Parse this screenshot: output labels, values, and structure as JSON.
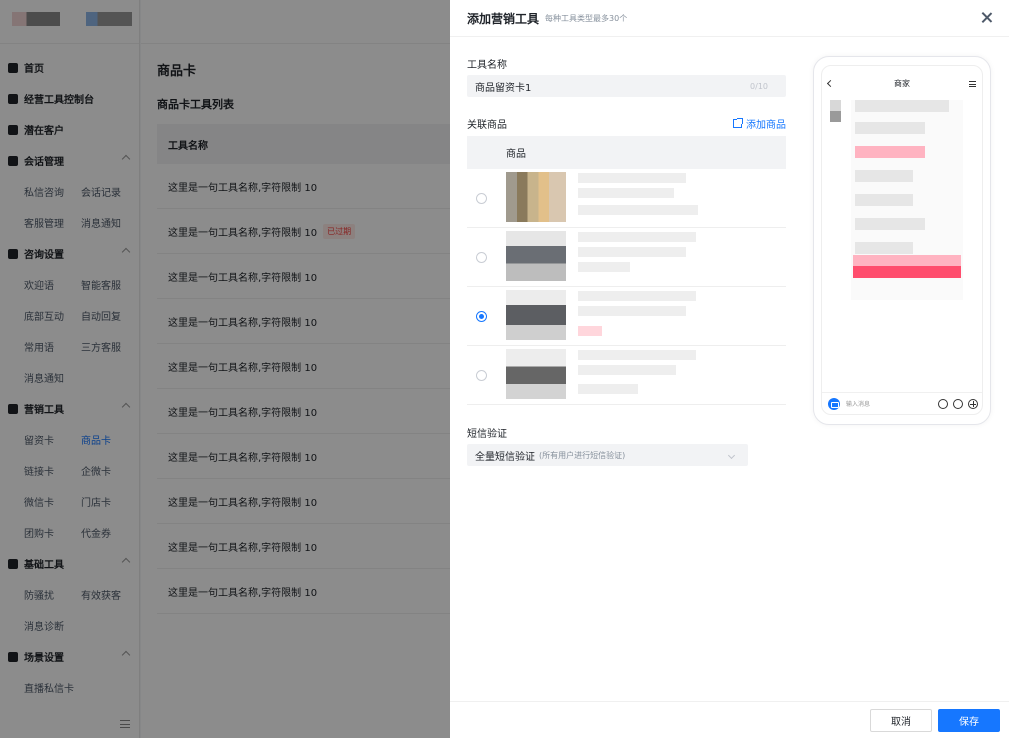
{
  "sidebar": {
    "groups": [
      {
        "label": "首页",
        "items": []
      },
      {
        "label": "经营工具控制台",
        "items": []
      },
      {
        "label": "潜在客户",
        "items": []
      },
      {
        "label": "会话管理",
        "items": [
          "私信咨询",
          "会话记录",
          "客服管理",
          "消息通知"
        ]
      },
      {
        "label": "咨询设置",
        "items": [
          "欢迎语",
          "智能客服",
          "底部互动",
          "自动回复",
          "常用语",
          "三方客服",
          "消息通知"
        ]
      },
      {
        "label": "营销工具",
        "items": [
          "留资卡",
          "商品卡",
          "链接卡",
          "企微卡",
          "微信卡",
          "门店卡",
          "团购卡",
          "代金券"
        ]
      },
      {
        "label": "基础工具",
        "items": [
          "防骚扰",
          "有效获客",
          "消息诊断"
        ]
      },
      {
        "label": "场景设置",
        "items": [
          "直播私信卡"
        ]
      }
    ],
    "active_item": "商品卡"
  },
  "main": {
    "page_title": "商品卡",
    "list_title": "商品卡工具列表",
    "column_tool_name": "工具名称",
    "rows": [
      "这里是一句工具名称,字符限制 10",
      "这里是一句工具名称,字符限制 10",
      "这里是一句工具名称,字符限制 10",
      "这里是一句工具名称,字符限制 10",
      "这里是一句工具名称,字符限制 10",
      "这里是一句工具名称,字符限制 10",
      "这里是一句工具名称,字符限制 10",
      "这里是一句工具名称,字符限制 10",
      "这里是一句工具名称,字符限制 10",
      "这里是一句工具名称,字符限制 10"
    ],
    "expired_tag": "已过期"
  },
  "drawer": {
    "title": "添加营销工具",
    "subtitle": "每种工具类型最多30个",
    "tool_name_label": "工具名称",
    "tool_name_value": "商品留资卡1",
    "tool_name_count": "0/10",
    "goods_label": "关联商品",
    "add_goods": "添加商品",
    "goods_column": "商品",
    "selected_goods_index": 2,
    "sms_label": "短信验证",
    "sms_value": "全量短信验证",
    "sms_hint": "(所有用户进行短信验证)",
    "cancel": "取消",
    "save": "保存"
  },
  "phone": {
    "title": "商家",
    "input_placeholder": "输入消息"
  },
  "colors": {
    "primary": "#1677ff",
    "danger": "#f53f3f",
    "pink": "#ff4d6d"
  }
}
